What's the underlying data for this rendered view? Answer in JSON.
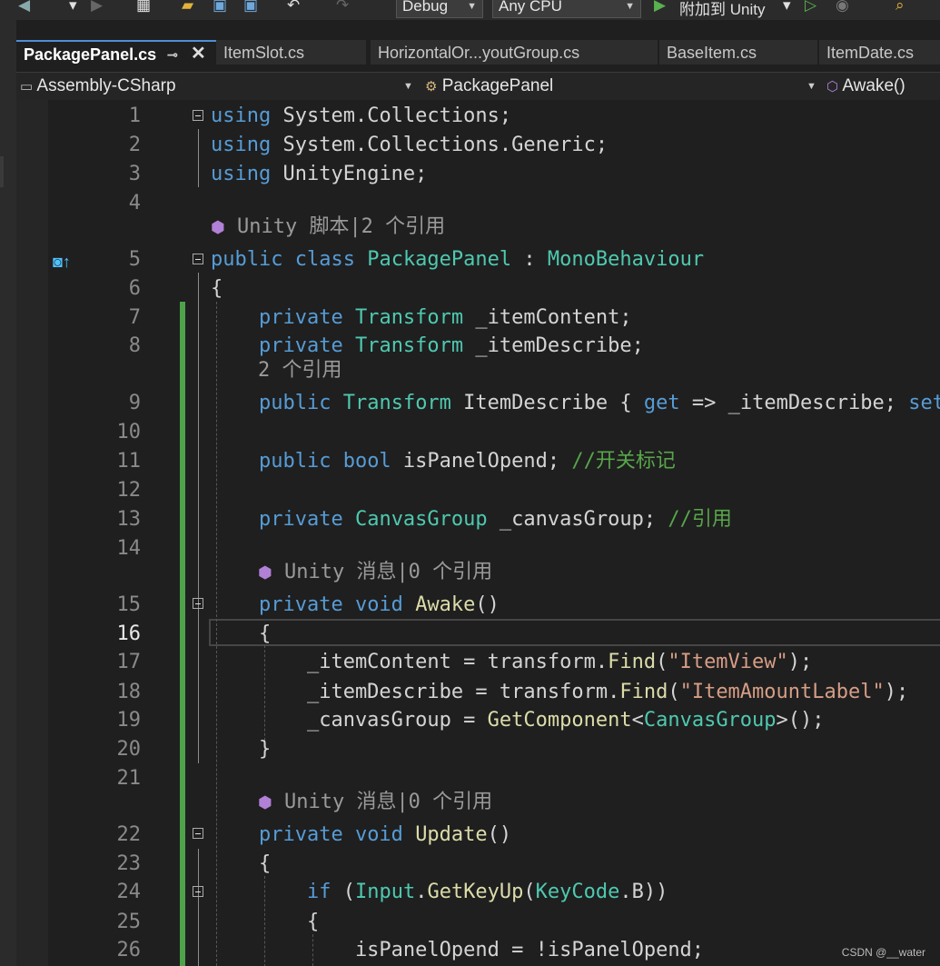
{
  "toolbar": {
    "config": "Debug",
    "platform": "Any CPU",
    "attach_label": "附加到 Unity"
  },
  "tabs": [
    {
      "label": "PackagePanel.cs",
      "active": true
    },
    {
      "label": "ItemSlot.cs"
    },
    {
      "label": "HorizontalOr...youtGroup.cs"
    },
    {
      "label": "BaseItem.cs"
    },
    {
      "label": "ItemDate.cs"
    }
  ],
  "navbar": {
    "project": "Assembly-CSharp",
    "class": "PackagePanel",
    "member": "Awake()"
  },
  "lines": [
    {
      "n": "1",
      "html": "<span class='kw'>using</span> System.Collections;"
    },
    {
      "n": "2",
      "html": "<span class='kw'>using</span> System.Collections.Generic;"
    },
    {
      "n": "3",
      "html": "<span class='kw'>using</span> UnityEngine;"
    },
    {
      "n": "4",
      "html": ""
    },
    {
      "n": "5",
      "html": "<span class='kw'>public class</span> <span class='ty'>PackagePanel</span> : <span class='ty'>MonoBehaviour</span>"
    },
    {
      "n": "6",
      "html": "{"
    },
    {
      "n": "7",
      "html": "    <span class='kw'>private</span> <span class='ty'>Transform</span> _itemContent;"
    },
    {
      "n": "8",
      "html": "    <span class='kw'>private</span> <span class='ty'>Transform</span> _itemDescribe;"
    },
    {
      "n": "9",
      "html": "    <span class='kw'>public</span> <span class='ty'>Transform</span> ItemDescribe { <span class='kw'>get</span> => _itemDescribe; <span class='kw'>set</span>"
    },
    {
      "n": "10",
      "html": ""
    },
    {
      "n": "11",
      "html": "    <span class='kw'>public bool</span> isPanelOpend; <span class='cm'>//开关标记</span>"
    },
    {
      "n": "12",
      "html": ""
    },
    {
      "n": "13",
      "html": "    <span class='kw'>private</span> <span class='ty'>CanvasGroup</span> _canvasGroup; <span class='cm'>//引用</span>"
    },
    {
      "n": "14",
      "html": ""
    },
    {
      "n": "15",
      "html": "    <span class='kw'>private void</span> <span class='fn'>Awake</span>()"
    },
    {
      "n": "16",
      "html": "    {"
    },
    {
      "n": "17",
      "html": "        _itemContent = transform.<span class='fn'>Find</span>(<span class='st'>\"ItemView\"</span>);"
    },
    {
      "n": "18",
      "html": "        _itemDescribe = transform.<span class='fn'>Find</span>(<span class='st'>\"ItemAmountLabel\"</span>);"
    },
    {
      "n": "19",
      "html": "        _canvasGroup = <span class='fn'>GetComponent</span>&lt;<span class='ty'>CanvasGroup</span>&gt;();"
    },
    {
      "n": "20",
      "html": "    }"
    },
    {
      "n": "21",
      "html": ""
    },
    {
      "n": "22",
      "html": "    <span class='kw'>private void</span> <span class='fn'>Update</span>()"
    },
    {
      "n": "23",
      "html": "    {"
    },
    {
      "n": "24",
      "html": "        <span class='kw'>if</span> (<span class='ty'>Input</span>.<span class='fn'>GetKeyUp</span>(<span class='ty'>KeyCode</span>.B))"
    },
    {
      "n": "25",
      "html": "        {"
    },
    {
      "n": "26",
      "html": "            isPanelOpend = !isPanelOpend;"
    }
  ],
  "lens": {
    "class_refs": "Unity 脚本|2 个引用",
    "prop_refs": "2 个引用",
    "awake_refs": "Unity 消息|0 个引用",
    "update_refs": "Unity 消息|0 个引用"
  },
  "watermark": "CSDN @__water"
}
